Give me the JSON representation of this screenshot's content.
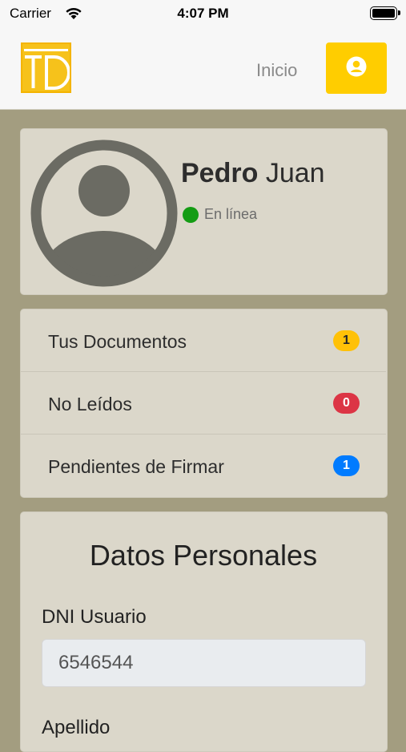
{
  "status_bar": {
    "carrier": "Carrier",
    "time": "4:07 PM"
  },
  "navbar": {
    "logo_text": "TD",
    "inicio_label": "Inicio",
    "user_button_icon": "user-circle-icon"
  },
  "profile": {
    "first_name": "Pedro",
    "last_name": "Juan",
    "status": "En línea",
    "status_color": "#149c14"
  },
  "menu": {
    "items": [
      {
        "label": "Tus Documentos",
        "count": "1",
        "badge_color": "#ffc107",
        "badge_text_color": "#212529"
      },
      {
        "label": "No Leídos",
        "count": "0",
        "badge_color": "#dc3545",
        "badge_text_color": "#ffffff"
      },
      {
        "label": "Pendientes de Firmar",
        "count": "1",
        "badge_color": "#007bff",
        "badge_text_color": "#ffffff"
      }
    ]
  },
  "personal": {
    "title": "Datos Personales",
    "dni_label": "DNI Usuario",
    "dni_value": "6546544",
    "next_label": "Apellido"
  },
  "colors": {
    "brand_yellow": "#ffcd00",
    "background": "#a39d80",
    "card": "#dbd7ca"
  }
}
